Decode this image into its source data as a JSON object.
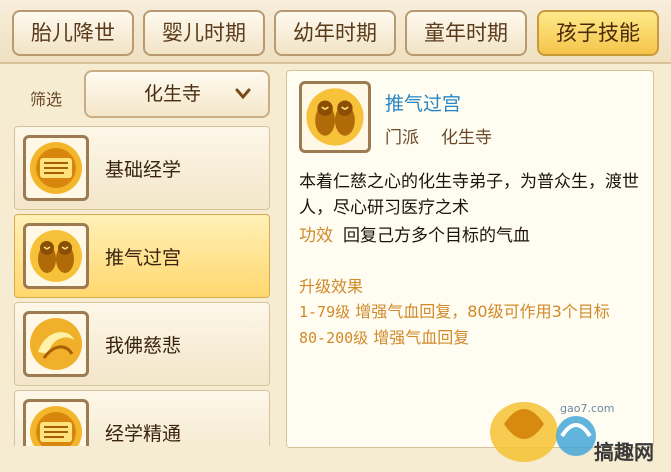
{
  "tabs": [
    {
      "label": "胎儿降世",
      "active": false
    },
    {
      "label": "婴儿时期",
      "active": false
    },
    {
      "label": "幼年时期",
      "active": false
    },
    {
      "label": "童年时期",
      "active": false
    },
    {
      "label": "孩子技能",
      "active": true
    }
  ],
  "filter": {
    "label": "筛选",
    "value": "化生寺",
    "chevron_icon": "chevron-down-icon"
  },
  "skills": [
    {
      "name": "基础经学",
      "icon": "scroll-skill-icon"
    },
    {
      "name": "推气过宫",
      "icon": "twin-monk-skill-icon",
      "selected": true
    },
    {
      "name": "我佛慈悲",
      "icon": "swirl-skill-icon"
    },
    {
      "name": "经学精通",
      "icon": "scroll-skill-icon"
    }
  ],
  "detail": {
    "title": "推气过宫",
    "sect_label": "门派",
    "sect_value": "化生寺",
    "description": "本着仁慈之心的化生寺弟子，为普众生，渡世人，尽心研习医疗之术",
    "effect_label": "功效",
    "effect_value": "回复己方多个目标的气血",
    "upgrade_title": "升级效果",
    "upgrade_lines": [
      {
        "range": "1-79级",
        "text": "增强气血回复，80级可作用3个目标"
      },
      {
        "range": "80-200级",
        "text": "增强气血回复"
      }
    ]
  },
  "watermark": {
    "site": "gao7.com",
    "text": "搞趣网"
  },
  "colors": {
    "accent_blue": "#2a86c6",
    "label_orange": "#d08a2a",
    "selected_gold": "#ffd76e"
  }
}
